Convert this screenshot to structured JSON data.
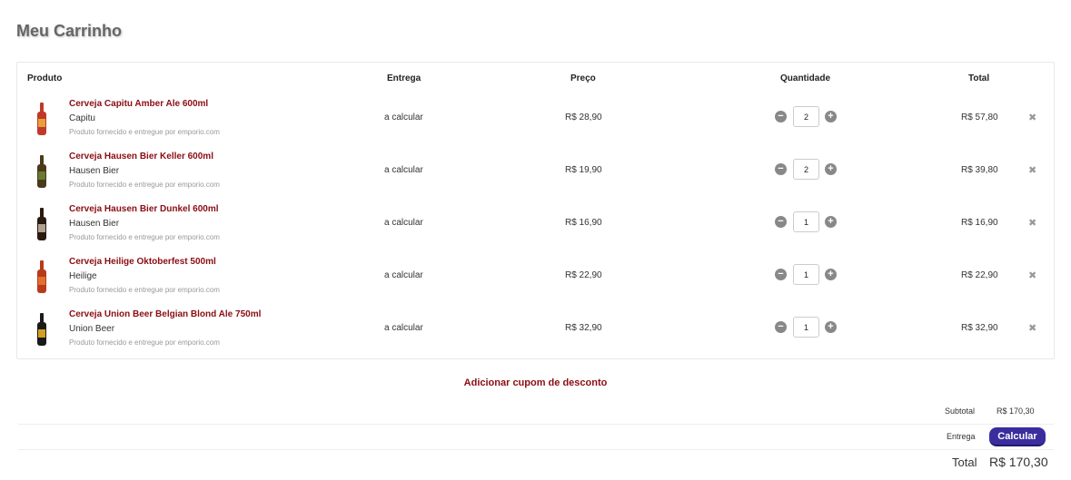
{
  "page": {
    "title": "Meu Carrinho"
  },
  "headers": {
    "produto": "Produto",
    "entrega": "Entrega",
    "preco": "Preço",
    "quantidade": "Quantidade",
    "total": "Total"
  },
  "items": [
    {
      "name": "Cerveja Capitu Amber Ale 600ml",
      "brand": "Capitu",
      "seller": "Produto fornecido e entregue por emporio.com",
      "delivery": "a calcular",
      "price": "R$ 28,90",
      "qty": "2",
      "total": "R$ 57,80",
      "bottle_color": "#c0392b",
      "label_color": "#e8a03a"
    },
    {
      "name": "Cerveja Hausen Bier Keller 600ml",
      "brand": "Hausen Bier",
      "seller": "Produto fornecido e entregue por emporio.com",
      "delivery": "a calcular",
      "price": "R$ 19,90",
      "qty": "2",
      "total": "R$ 39,80",
      "bottle_color": "#4a3a1a",
      "label_color": "#6a7a30"
    },
    {
      "name": "Cerveja Hausen Bier Dunkel 600ml",
      "brand": "Hausen Bier",
      "seller": "Produto fornecido e entregue por emporio.com",
      "delivery": "a calcular",
      "price": "R$ 16,90",
      "qty": "1",
      "total": "R$ 16,90",
      "bottle_color": "#2a1a10",
      "label_color": "#b0a090"
    },
    {
      "name": "Cerveja Heilige Oktoberfest 500ml",
      "brand": "Heilige",
      "seller": "Produto fornecido e entregue por emporio.com",
      "delivery": "a calcular",
      "price": "R$ 22,90",
      "qty": "1",
      "total": "R$ 22,90",
      "bottle_color": "#b83a1a",
      "label_color": "#e07030"
    },
    {
      "name": "Cerveja Union Beer Belgian Blond Ale 750ml",
      "brand": "Union Beer",
      "seller": "Produto fornecido e entregue por emporio.com",
      "delivery": "a calcular",
      "price": "R$ 32,90",
      "qty": "1",
      "total": "R$ 32,90",
      "bottle_color": "#1a1a1a",
      "label_color": "#d4a020"
    }
  ],
  "coupon": {
    "label": "Adicionar cupom de desconto"
  },
  "summary": {
    "subtotal_label": "Subtotal",
    "subtotal_value": "R$ 170,30",
    "delivery_label": "Entrega",
    "calc_button": "Calcular",
    "total_label": "Total",
    "total_value": "R$ 170,30"
  },
  "icons": {
    "minus": "minus-circle-icon",
    "plus": "plus-circle-icon",
    "remove": "close-icon"
  },
  "colors": {
    "accent": "#8b0d13",
    "button": "#3a2e9e"
  }
}
